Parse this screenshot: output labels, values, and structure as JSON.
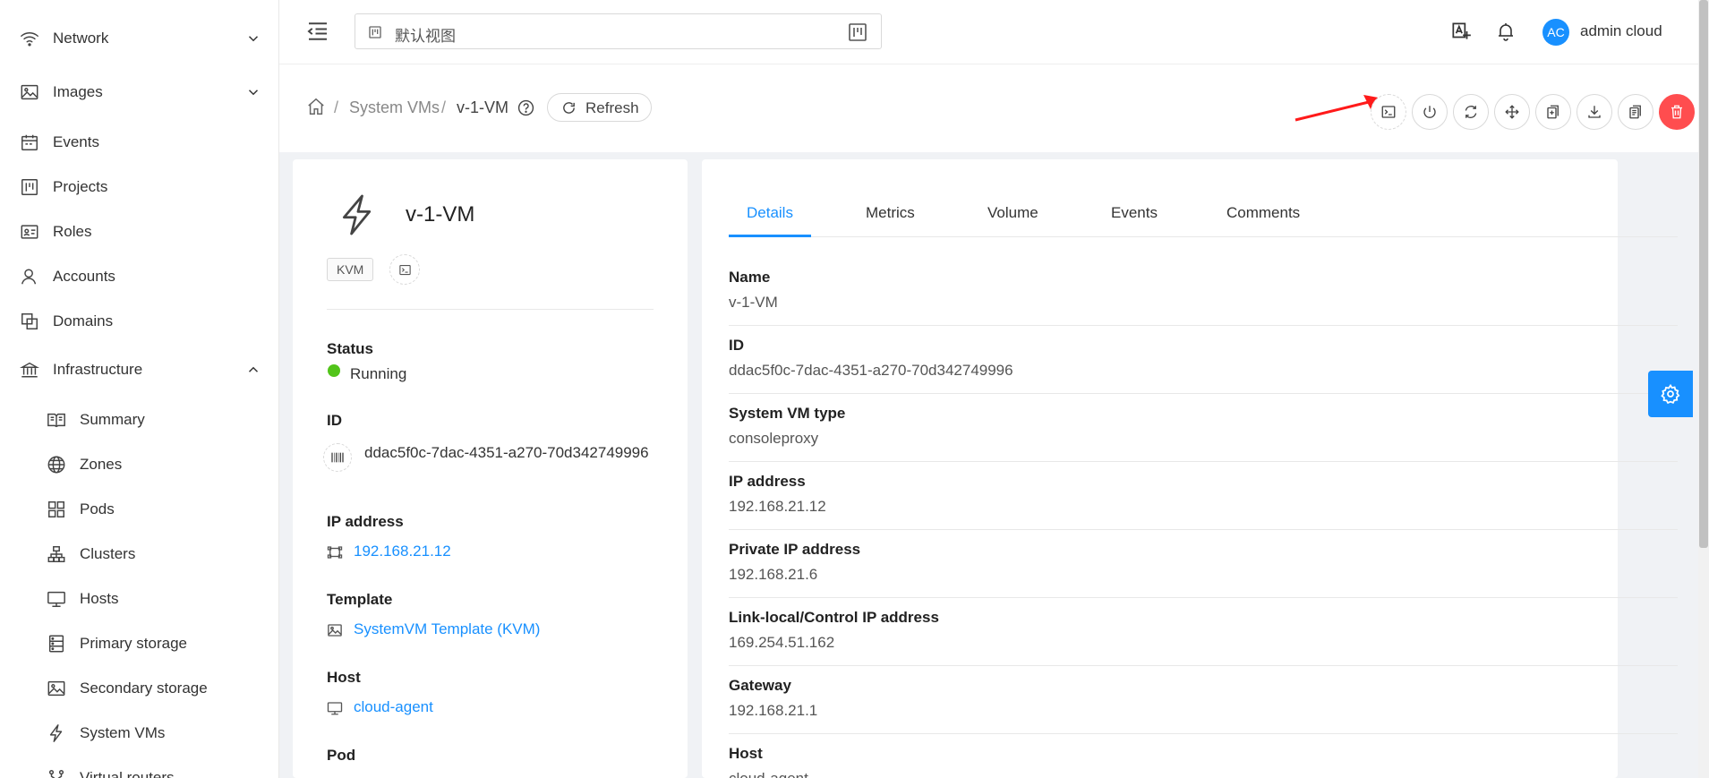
{
  "sidebar": {
    "items": [
      {
        "label": "Network",
        "icon": "wifi-icon",
        "chevron": "down"
      },
      {
        "label": "Images",
        "icon": "picture-icon",
        "chevron": "down"
      },
      {
        "label": "Events",
        "icon": "calendar-icon"
      },
      {
        "label": "Projects",
        "icon": "project-icon"
      },
      {
        "label": "Roles",
        "icon": "idcard-icon"
      },
      {
        "label": "Accounts",
        "icon": "user-icon"
      },
      {
        "label": "Domains",
        "icon": "block-icon"
      },
      {
        "label": "Infrastructure",
        "icon": "bank-icon",
        "chevron": "up"
      },
      {
        "label": "Summary",
        "icon": "read-icon"
      },
      {
        "label": "Zones",
        "icon": "global-icon"
      },
      {
        "label": "Pods",
        "icon": "appstore-icon"
      },
      {
        "label": "Clusters",
        "icon": "cluster-icon"
      },
      {
        "label": "Hosts",
        "icon": "desktop-icon"
      },
      {
        "label": "Primary storage",
        "icon": "database-icon"
      },
      {
        "label": "Secondary storage",
        "icon": "picture-icon"
      },
      {
        "label": "System VMs",
        "icon": "thunderbolt-icon"
      },
      {
        "label": "Virtual routers",
        "icon": "fork-icon"
      }
    ]
  },
  "header": {
    "project_placeholder": "默认视图",
    "user_initials": "AC",
    "user_name": "admin cloud"
  },
  "breadcrumb": {
    "section": "System VMs",
    "current": "v-1-VM",
    "refresh_label": "Refresh"
  },
  "actions": [
    "console",
    "stop",
    "reboot",
    "migrate",
    "scale",
    "download",
    "copy",
    "destroy"
  ],
  "vm_card": {
    "title": "v-1-VM",
    "hypervisor_tag": "KVM",
    "status_label": "Status",
    "status_value": "Running",
    "status_color": "#52c41a",
    "id_label": "ID",
    "id_value": "ddac5f0c-7dac-4351-a270-70d342749996",
    "ip_label": "IP address",
    "ip_value": "192.168.21.12",
    "template_label": "Template",
    "template_value": "SystemVM Template (KVM)",
    "host_label": "Host",
    "host_value": "cloud-agent",
    "pod_label": "Pod"
  },
  "tabs": [
    {
      "label": "Details",
      "active": true
    },
    {
      "label": "Metrics"
    },
    {
      "label": "Volume"
    },
    {
      "label": "Events"
    },
    {
      "label": "Comments"
    }
  ],
  "details": [
    {
      "label": "Name",
      "value": "v-1-VM"
    },
    {
      "label": "ID",
      "value": "ddac5f0c-7dac-4351-a270-70d342749996"
    },
    {
      "label": "System VM type",
      "value": "consoleproxy"
    },
    {
      "label": "IP address",
      "value": "192.168.21.12"
    },
    {
      "label": "Private IP address",
      "value": "192.168.21.6"
    },
    {
      "label": "Link-local/Control IP address",
      "value": "169.254.51.162"
    },
    {
      "label": "Gateway",
      "value": "192.168.21.1"
    },
    {
      "label": "Host",
      "value": "cloud-agent"
    }
  ],
  "colors": {
    "primary": "#1890ff",
    "danger": "#ff4d4f",
    "annotation_arrow": "#ff1a1a"
  }
}
